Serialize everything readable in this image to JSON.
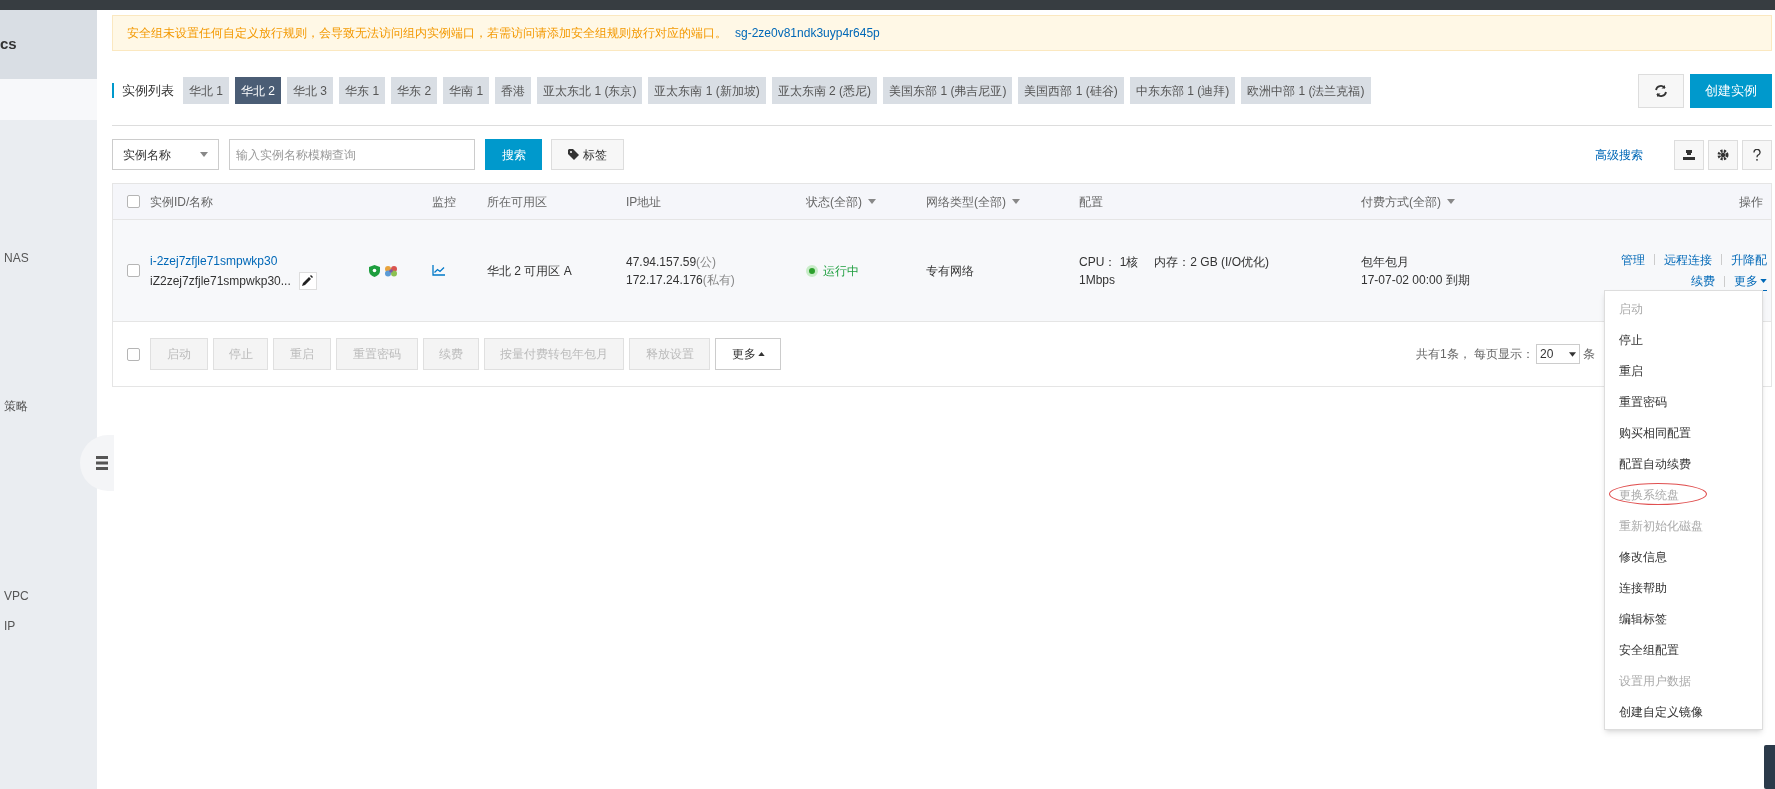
{
  "sidebar": {
    "header": "cs",
    "items": [
      "NAS",
      "策略",
      "VPC",
      "IP"
    ]
  },
  "notice": {
    "text": "安全组未设置任何自定义放行规则，会导致无法访问组内实例端口，若需访问请添加安全组规则放行对应的端口。",
    "link": "sg-2ze0v81ndk3uyp4r645p"
  },
  "region_tabs": {
    "label": "实例列表",
    "tabs": [
      {
        "label": "华北 1",
        "selected": false
      },
      {
        "label": "华北 2",
        "selected": true
      },
      {
        "label": "华北 3",
        "selected": false
      },
      {
        "label": "华东 1",
        "selected": false
      },
      {
        "label": "华东 2",
        "selected": false
      },
      {
        "label": "华南 1",
        "selected": false
      },
      {
        "label": "香港",
        "selected": false
      },
      {
        "label": "亚太东北 1 (东京)",
        "selected": false
      },
      {
        "label": "亚太东南 1 (新加坡)",
        "selected": false
      },
      {
        "label": "亚太东南 2 (悉尼)",
        "selected": false
      },
      {
        "label": "美国东部 1 (弗吉尼亚)",
        "selected": false
      },
      {
        "label": "美国西部 1 (硅谷)",
        "selected": false
      },
      {
        "label": "中东东部 1 (迪拜)",
        "selected": false
      },
      {
        "label": "欧洲中部 1 (法兰克福)",
        "selected": false
      }
    ],
    "create_button": "创建实例"
  },
  "toolbar": {
    "filter_select": "实例名称",
    "search_placeholder": "输入实例名称模糊查询",
    "search_button": "搜索",
    "tag_button": "标签",
    "advanced_search": "高级搜索"
  },
  "table": {
    "header_checked": false,
    "columns": [
      {
        "label": "实例ID/名称",
        "filter": false
      },
      {
        "label": "监控",
        "filter": false
      },
      {
        "label": "所在可用区",
        "filter": false
      },
      {
        "label": "IP地址",
        "filter": false
      },
      {
        "label": "状态(全部)",
        "filter": true
      },
      {
        "label": "网络类型(全部)",
        "filter": true
      },
      {
        "label": "配置",
        "filter": false
      },
      {
        "label": "付费方式(全部)",
        "filter": true
      },
      {
        "label": "操作",
        "filter": false
      }
    ],
    "rows": [
      {
        "checked": false,
        "id": "i-2zej7zfjle71smpwkp30",
        "name": "iZ2zej7zfjle71smpwkp30...",
        "zone": "华北 2 可用区 A",
        "ip_public": "47.94.157.59",
        "ip_public_tag": "(公)",
        "ip_private": "172.17.24.176",
        "ip_private_tag": "(私有)",
        "status": {
          "kind": "running",
          "text": "运行中"
        },
        "network": "专有网络",
        "cpu": "CPU： 1核",
        "memory": "内存：2 GB (I/O优化)",
        "bandwidth": "1Mbps",
        "billing": "包年包月",
        "expiry": "17-07-02 00:00 到期",
        "actions": [
          [
            "管理",
            "远程连接",
            "升降配"
          ],
          [
            "续费",
            "更多"
          ]
        ]
      }
    ]
  },
  "batch": {
    "checked": false,
    "buttons": [
      {
        "label": "启动",
        "disabled": true
      },
      {
        "label": "停止",
        "disabled": true
      },
      {
        "label": "重启",
        "disabled": true
      },
      {
        "label": "重置密码",
        "disabled": true
      },
      {
        "label": "续费",
        "disabled": true
      },
      {
        "label": "按量付费转包年包月",
        "disabled": true
      },
      {
        "label": "释放设置",
        "disabled": true
      },
      {
        "label": "更多",
        "disabled": false
      }
    ]
  },
  "pagination": {
    "text": "共有1条， 每页显示：",
    "page_size": "20",
    "unit": "条"
  },
  "more_menu": {
    "items": [
      {
        "label": "启动",
        "disabled": true,
        "annotated": false
      },
      {
        "label": "停止",
        "disabled": false,
        "annotated": false
      },
      {
        "label": "重启",
        "disabled": false,
        "annotated": false
      },
      {
        "label": "重置密码",
        "disabled": false,
        "annotated": false
      },
      {
        "label": "购买相同配置",
        "disabled": false,
        "annotated": false
      },
      {
        "label": "配置自动续费",
        "disabled": false,
        "annotated": false
      },
      {
        "label": "更换系统盘",
        "disabled": true,
        "annotated": true
      },
      {
        "label": "重新初始化磁盘",
        "disabled": true,
        "annotated": false
      },
      {
        "label": "修改信息",
        "disabled": false,
        "annotated": false
      },
      {
        "label": "连接帮助",
        "disabled": false,
        "annotated": false
      },
      {
        "label": "编辑标签",
        "disabled": false,
        "annotated": false
      },
      {
        "label": "安全组配置",
        "disabled": false,
        "annotated": false
      },
      {
        "label": "设置用户数据",
        "disabled": true,
        "annotated": false
      },
      {
        "label": "创建自定义镜像",
        "disabled": false,
        "annotated": false
      }
    ]
  }
}
